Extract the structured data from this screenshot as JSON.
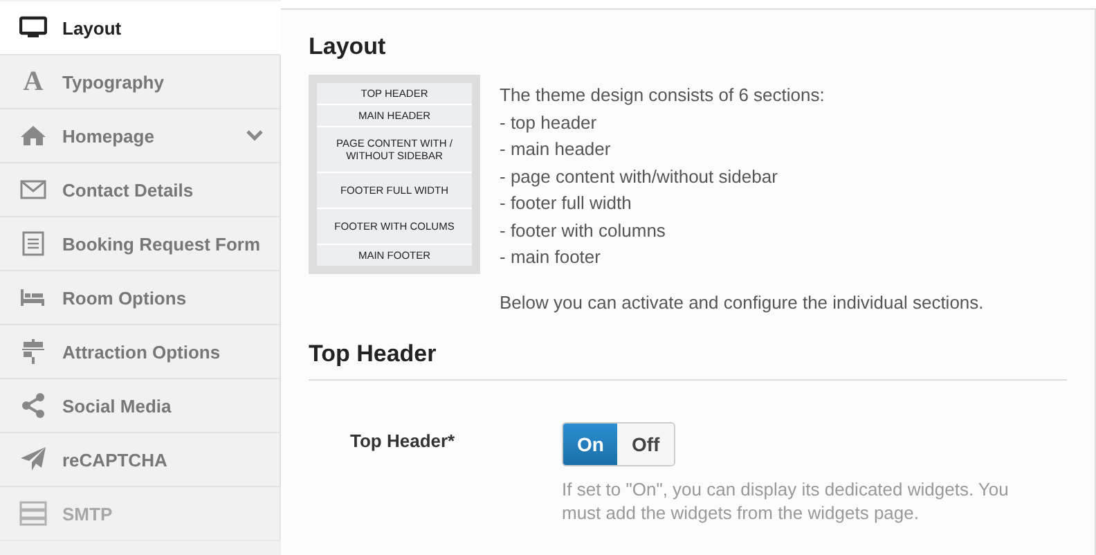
{
  "sidebar": {
    "items": [
      {
        "label": "Layout",
        "selected": true,
        "expandable": false
      },
      {
        "label": "Typography",
        "glyph": "A",
        "selected": false,
        "expandable": false
      },
      {
        "label": "Homepage",
        "selected": false,
        "expandable": true
      },
      {
        "label": "Contact Details",
        "selected": false,
        "expandable": false
      },
      {
        "label": "Booking Request Form",
        "selected": false,
        "expandable": false
      },
      {
        "label": "Room Options",
        "selected": false,
        "expandable": false
      },
      {
        "label": "Attraction Options",
        "selected": false,
        "expandable": false
      },
      {
        "label": "Social Media",
        "selected": false,
        "expandable": false
      },
      {
        "label": "reCAPTCHA",
        "selected": false,
        "expandable": false
      },
      {
        "label": "SMTP",
        "selected": false,
        "expandable": false
      }
    ]
  },
  "layout_section": {
    "title": "Layout",
    "diagram": [
      "TOP HEADER",
      "MAIN HEADER",
      "PAGE CONTENT WITH / WITHOUT SIDEBAR",
      "FOOTER FULL WIDTH",
      "FOOTER WITH COLUMS",
      "MAIN FOOTER"
    ],
    "intro": "The theme design consists of 6 sections:",
    "list": [
      "- top header",
      "- main header",
      "- page content with/without sidebar",
      "- footer full width",
      "- footer with columns",
      "- main footer"
    ],
    "note": "Below you can activate and configure the individual sections."
  },
  "top_header_section": {
    "title": "Top Header",
    "field": {
      "label": "Top Header*",
      "options": [
        {
          "label": "On",
          "selected": true
        },
        {
          "label": "Off",
          "selected": false
        }
      ],
      "help": [
        "If set to \"On\", you can display its dedicated widgets. You",
        "must add the widgets from the widgets page."
      ]
    }
  }
}
